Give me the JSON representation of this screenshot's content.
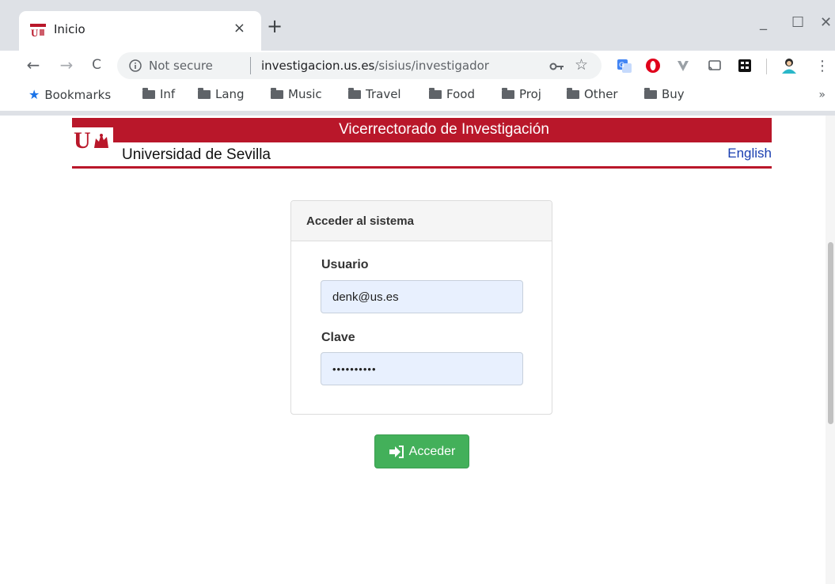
{
  "browser": {
    "tab": {
      "title": "Inicio",
      "close_glyph": "×"
    },
    "newtab_glyph": "+",
    "window_controls": {
      "minimize": "_",
      "maximize": "☐",
      "close": "✕"
    },
    "nav": {
      "back": "←",
      "forward": "→",
      "reload": "C"
    },
    "omnibox": {
      "security_text": "Not secure",
      "host": "investigacion.us.es",
      "path": "/sisius/investigador"
    },
    "bookmarks": {
      "label": "Bookmarks",
      "folders": [
        "Inf",
        "Lang",
        "Music",
        "Travel",
        "Food",
        "Proj",
        "Other",
        "Buy"
      ],
      "more": "»"
    }
  },
  "header": {
    "band_title": "Vicerrectorado de Investigación",
    "university": "Universidad de Sevilla",
    "language_link": "English",
    "logo_letter": "U",
    "brand_color": "#b9172a"
  },
  "login": {
    "panel_title": "Acceder al sistema",
    "user_label": "Usuario",
    "user_value": "denk@us.es",
    "password_label": "Clave",
    "password_value": "••••••••••",
    "submit_label": "Acceder",
    "submit_color": "#43b05a"
  }
}
